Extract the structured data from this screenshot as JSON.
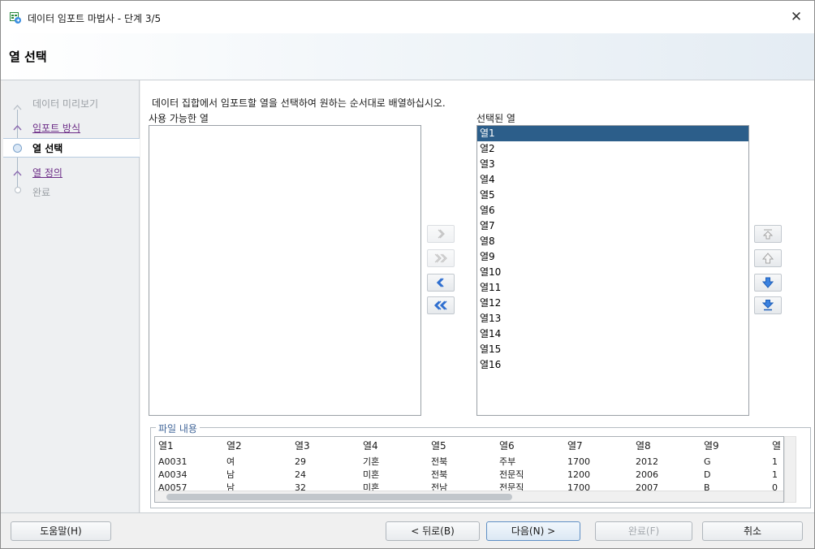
{
  "window": {
    "title": "데이터 임포트 마법사 - 단계 3/5",
    "close_glyph": "✕"
  },
  "header": {
    "title": "열 선택"
  },
  "nav": {
    "items": [
      {
        "label": "데이터 미리보기",
        "state": "disabled"
      },
      {
        "label": "임포트 방식",
        "state": "link"
      },
      {
        "label": "열 선택",
        "state": "current"
      },
      {
        "label": "열 정의",
        "state": "link"
      },
      {
        "label": "완료",
        "state": "disabled"
      }
    ]
  },
  "main": {
    "instruction": "데이터 집합에서 임포트할 열을 선택하여 원하는 순서대로 배열하십시오.",
    "available_label": "사용 가능한 열",
    "selected_label": "선택된 열",
    "selected_columns": [
      "열1",
      "열2",
      "열3",
      "열4",
      "열5",
      "열6",
      "열7",
      "열8",
      "열9",
      "열10",
      "열11",
      "열12",
      "열13",
      "열14",
      "열15",
      "열16"
    ],
    "selected_index": 0
  },
  "preview": {
    "legend": "파일 내용",
    "headers": [
      "열1",
      "열2",
      "열3",
      "열4",
      "열5",
      "열6",
      "열7",
      "열8",
      "열9",
      "열"
    ],
    "rows": [
      [
        "A0031",
        "여",
        "29",
        "기혼",
        "전북",
        "주부",
        "1700",
        "2012",
        "G",
        "1"
      ],
      [
        "A0034",
        "남",
        "24",
        "미혼",
        "전북",
        "전문직",
        "1200",
        "2006",
        "D",
        "1"
      ],
      [
        "A0057",
        "남",
        "32",
        "미혼",
        "전남",
        "전문직",
        "1700",
        "2007",
        "B",
        "0"
      ]
    ]
  },
  "footer": {
    "help": "도움말(H)",
    "back": "< 뒤로(B)",
    "next": "다음(N) >",
    "finish": "완료(F)",
    "cancel": "취소"
  },
  "colors": {
    "selection": "#2c5e8a",
    "link": "#6b2b86",
    "arrow_blue": "#2f6fd0"
  }
}
